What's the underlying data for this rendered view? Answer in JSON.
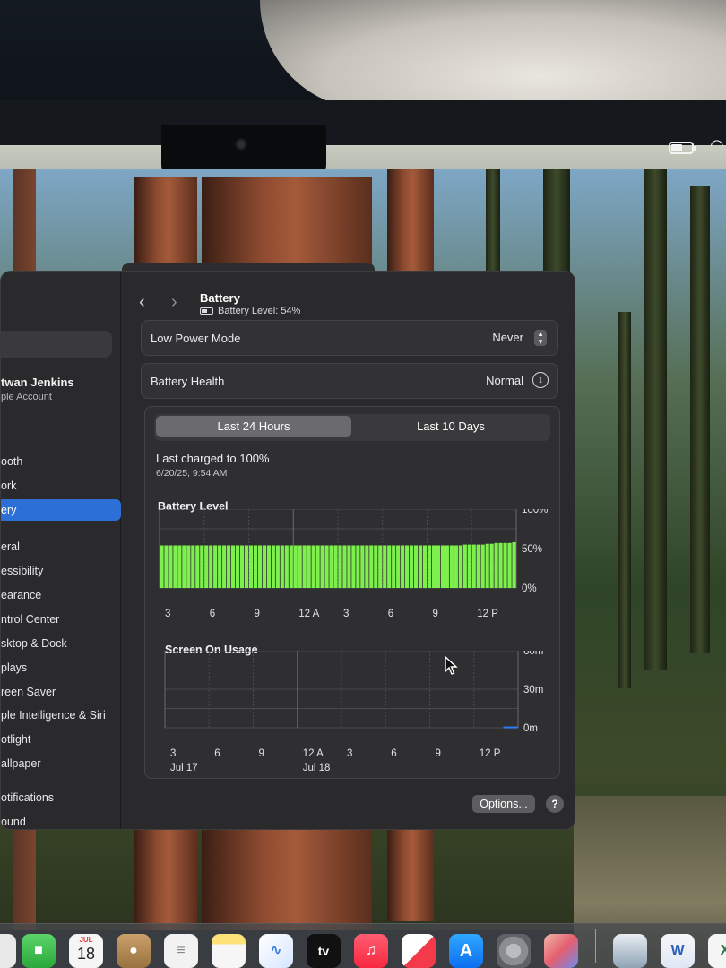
{
  "battery_pane": {
    "title": "Battery",
    "subtitle": "Battery Level: 54%",
    "low_power_mode": {
      "label": "Low Power Mode",
      "value": "Never"
    },
    "battery_health": {
      "label": "Battery Health",
      "value": "Normal"
    },
    "tabs": {
      "active": "Last 24 Hours",
      "inactive": "Last 10 Days"
    },
    "last_charged": {
      "label": "Last charged to 100%",
      "date": "6/20/25, 9:54 AM"
    },
    "options_label": "Options...",
    "help_label": "?"
  },
  "sidebar": {
    "account_name": "twan Jenkins",
    "account_sub": "ple Account",
    "items": [
      "ooth",
      "ork",
      "ery",
      "eral",
      "essibility",
      "earance",
      "ntrol Center",
      "sktop & Dock",
      "plays",
      "reen Saver",
      "ple Intelligence & Siri",
      "otlight",
      "allpaper",
      "otifications",
      "ound"
    ],
    "selected_index": 2
  },
  "dock": {
    "tv_label": "tv",
    "calendar_month": "JUL",
    "calendar_day": "18",
    "word_label": "W",
    "excel_label": "X"
  },
  "colors": {
    "battery_fill": "#7ef04e",
    "usage_line": "#2f7df6",
    "selected": "#2c6fd6"
  },
  "chart_data": [
    {
      "type": "bar",
      "title": "Battery Level",
      "x_tick_labels": [
        "3",
        "6",
        "9",
        "12 A",
        "3",
        "6",
        "9",
        "12 P"
      ],
      "y_tick_labels": [
        "100%",
        "50%",
        "0%"
      ],
      "ylim": [
        0,
        100
      ],
      "bar_count": 80,
      "values": [
        54,
        54,
        54,
        54,
        54,
        54,
        54,
        54,
        54,
        54,
        54,
        54,
        54,
        54,
        54,
        54,
        54,
        54,
        54,
        54,
        54,
        54,
        54,
        54,
        54,
        54,
        54,
        54,
        54,
        54,
        54,
        54,
        54,
        54,
        54,
        54,
        54,
        54,
        54,
        54,
        54,
        54,
        54,
        54,
        54,
        54,
        54,
        54,
        54,
        54,
        54,
        54,
        54,
        54,
        54,
        54,
        54,
        54,
        54,
        54,
        54,
        54,
        54,
        54,
        54,
        54,
        54,
        54,
        55,
        55,
        55,
        55,
        55,
        56,
        56,
        57,
        57,
        57,
        57,
        58
      ]
    },
    {
      "type": "bar",
      "title": "Screen On Usage",
      "x_tick_labels": [
        "3",
        "6",
        "9",
        "12 A",
        "3",
        "6",
        "9",
        "12 P"
      ],
      "date_labels": [
        "Jul 17",
        "Jul 18"
      ],
      "y_tick_labels": [
        "60m",
        "30m",
        "0m"
      ],
      "ylim": [
        0,
        60
      ],
      "values": [
        0,
        0,
        0,
        0,
        0,
        0,
        0,
        0,
        0,
        0,
        0,
        0,
        0,
        0,
        0,
        0,
        0,
        0,
        0,
        0,
        0,
        0,
        0,
        1
      ]
    }
  ]
}
